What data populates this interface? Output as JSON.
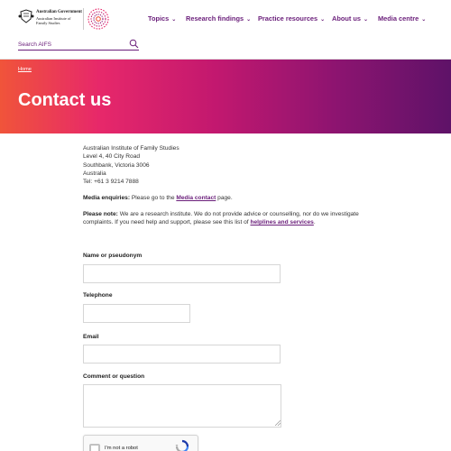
{
  "header": {
    "gov_line": "Australian Government",
    "aifs_line": "Australian Institute of Family Studies",
    "nav": [
      {
        "label": "Topics",
        "icon": "chevron-down-icon"
      },
      {
        "label": "Research findings",
        "icon": "chevron-down-icon"
      },
      {
        "label": "Practice resources",
        "icon": "chevron-down-icon"
      },
      {
        "label": "About us",
        "icon": "chevron-down-icon"
      },
      {
        "label": "Media centre",
        "icon": "chevron-down-icon"
      }
    ],
    "search_placeholder": "Search AIFS"
  },
  "hero": {
    "breadcrumb": "Home",
    "title": "Contact us"
  },
  "address": {
    "line1": "Australian Institute of Family Studies",
    "line2": "Level 4, 40 City Road",
    "line3": "Southbank, Victoria 3006",
    "line4": "Australia",
    "line5": "Tel: +61 3 9214 7888"
  },
  "media": {
    "label": "Media enquiries:",
    "text_before": " Please go to the ",
    "link": "Media contact",
    "text_after": " page."
  },
  "note": {
    "label": "Please note:",
    "text_before": " We are a research institute. We do not provide advice or counselling, nor do we investigate complaints. If you need help and support, please see this list of ",
    "link": "helplines and services",
    "text_after": "."
  },
  "form": {
    "name_label": "Name or pseudonym",
    "telephone_label": "Telephone",
    "email_label": "Email",
    "comment_label": "Comment or question",
    "captcha_label": "I'm not a robot"
  },
  "colors": {
    "brand_purple": "#6a1e7a",
    "gradient_start": "#f0543a",
    "gradient_mid": "#e7286a",
    "gradient_end": "#5e1268"
  }
}
